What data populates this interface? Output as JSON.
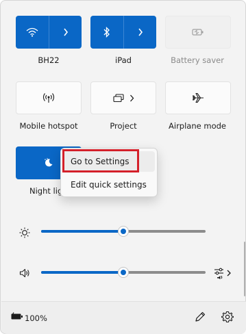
{
  "tiles": [
    {
      "label": "BH22",
      "state": "on",
      "icon": "wifi-icon",
      "chevron": "chevron-right-icon"
    },
    {
      "label": "iPad",
      "state": "on",
      "icon": "bluetooth-icon",
      "chevron": "chevron-right-icon"
    },
    {
      "label": "Battery saver",
      "state": "disabled",
      "icon": "battery-saver-icon"
    },
    {
      "label": "Mobile hotspot",
      "state": "off",
      "icon": "hotspot-icon"
    },
    {
      "label": "Project",
      "state": "off",
      "icon": "project-icon",
      "chevron": "chevron-right-icon"
    },
    {
      "label": "Airplane mode",
      "state": "off",
      "icon": "airplane-icon"
    },
    {
      "label": "Night light",
      "visible_label": "Night lig",
      "state": "on",
      "icon": "night-light-icon"
    }
  ],
  "sliders": {
    "brightness": {
      "icon": "brightness-icon",
      "value_fraction": 0.5
    },
    "volume": {
      "icon": "speaker-icon",
      "value_fraction": 0.5,
      "end_icon": "audio-output-icon"
    }
  },
  "context_menu": {
    "items": [
      {
        "label": "Go to Settings",
        "hovered": true,
        "highlighted": true
      },
      {
        "label": "Edit quick settings",
        "hovered": false
      }
    ]
  },
  "footer": {
    "battery_icon": "battery-charging-icon",
    "battery_text": "100%",
    "edit_icon": "pencil-icon",
    "settings_icon": "gear-icon"
  },
  "colors": {
    "accent": "#0a67c6",
    "highlight": "#d4202a",
    "panel_bg": "#f3f3f3"
  }
}
